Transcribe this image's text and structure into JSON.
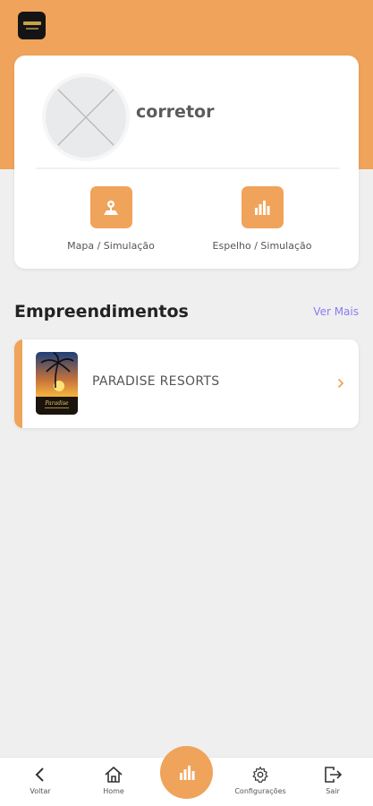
{
  "profile": {
    "name": "corretor",
    "actions": [
      {
        "label": "Mapa / Simulação",
        "icon": "map-pin-icon"
      },
      {
        "label": "Espelho / Simulação",
        "icon": "bar-chart-icon"
      }
    ]
  },
  "section": {
    "title": "Empreendimentos",
    "see_more": "Ver Mais"
  },
  "projects": [
    {
      "name": "PARADISE RESORTS",
      "thumb_text": "Paradise"
    }
  ],
  "nav": {
    "back": "Voltar",
    "home": "Home",
    "settings": "Configurações",
    "exit": "Sair"
  },
  "colors": {
    "accent": "#f0a35a",
    "link": "#8a7cf0",
    "background": "#efefef"
  }
}
